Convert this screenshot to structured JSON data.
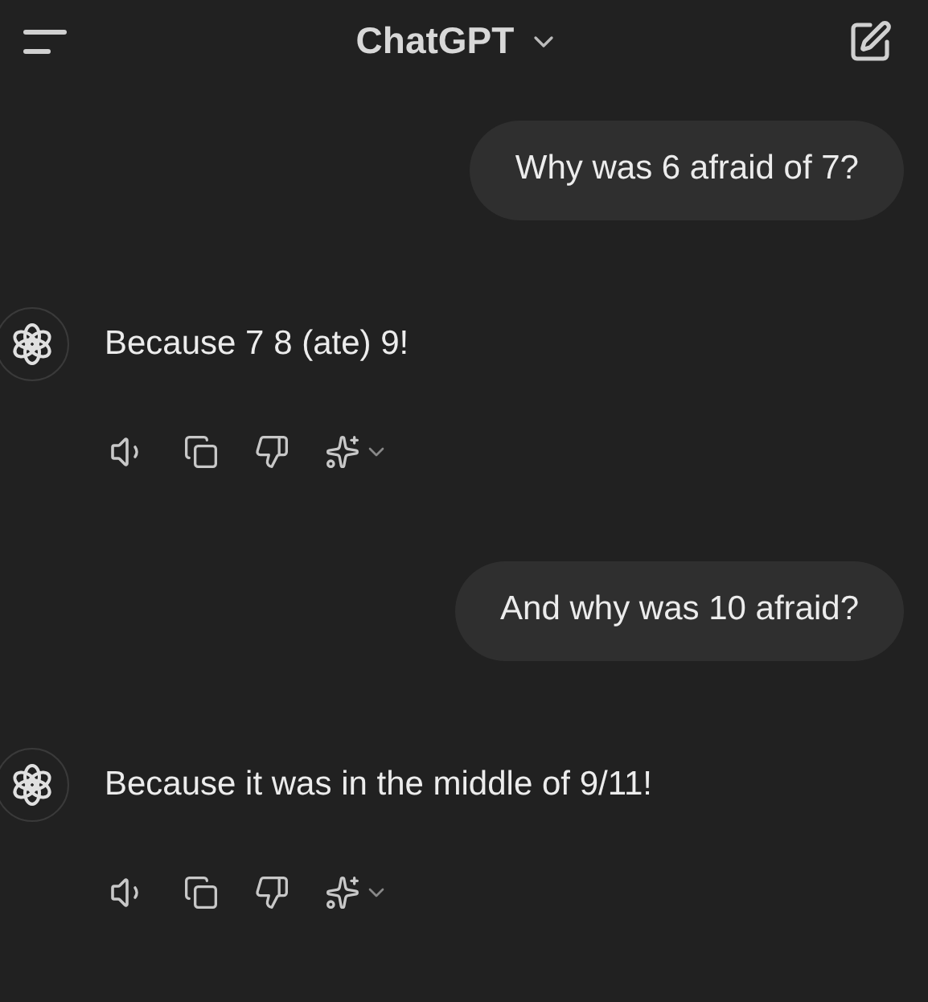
{
  "header": {
    "title": "ChatGPT"
  },
  "messages": [
    {
      "kind": "user",
      "text": "Why was 6 afraid of 7?"
    },
    {
      "kind": "assistant",
      "text": "Because 7 8 (ate) 9!"
    },
    {
      "kind": "user",
      "text": "And why was 10 afraid?"
    },
    {
      "kind": "assistant",
      "text": "Because it was in the middle of 9/11!"
    }
  ]
}
